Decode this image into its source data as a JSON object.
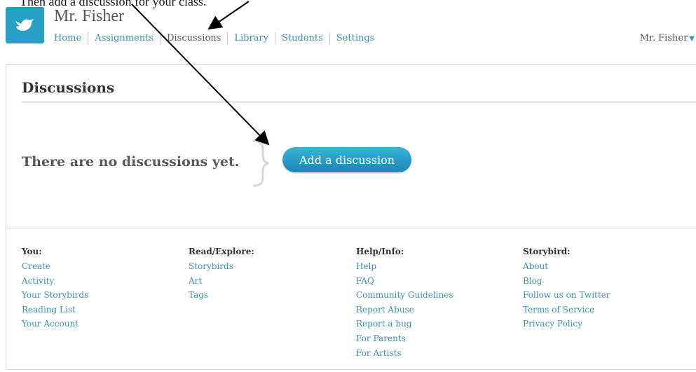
{
  "caption": "Then add a discussion for your class.",
  "header": {
    "title": "Mr. Fisher",
    "nav": [
      "Home",
      "Assignments",
      "Discussions",
      "Library",
      "Students",
      "Settings"
    ],
    "active_nav": "Discussions",
    "user": "Mr. Fisher",
    "logo_icon": "bird-icon",
    "accent_color": "#27a0c8"
  },
  "main": {
    "heading": "Discussions",
    "empty_message": "There are no discussions yet.",
    "add_button": "Add a discussion"
  },
  "footer": {
    "columns": [
      {
        "heading": "You:",
        "links": [
          "Create",
          "Activity",
          "Your Storybirds",
          "Reading List",
          "Your Account"
        ]
      },
      {
        "heading": "Read/Explore:",
        "links": [
          "Storybirds",
          "Art",
          "Tags"
        ]
      },
      {
        "heading": "Help/Info:",
        "links": [
          "Help",
          "FAQ",
          "Community Guidelines",
          "Report Abuse",
          "Report a bug",
          "For Parents",
          "For Artists"
        ]
      },
      {
        "heading": "Storybird:",
        "links": [
          "About",
          "Blog",
          "Follow us on Twitter",
          "Terms of Service",
          "Privacy Policy"
        ]
      }
    ]
  }
}
